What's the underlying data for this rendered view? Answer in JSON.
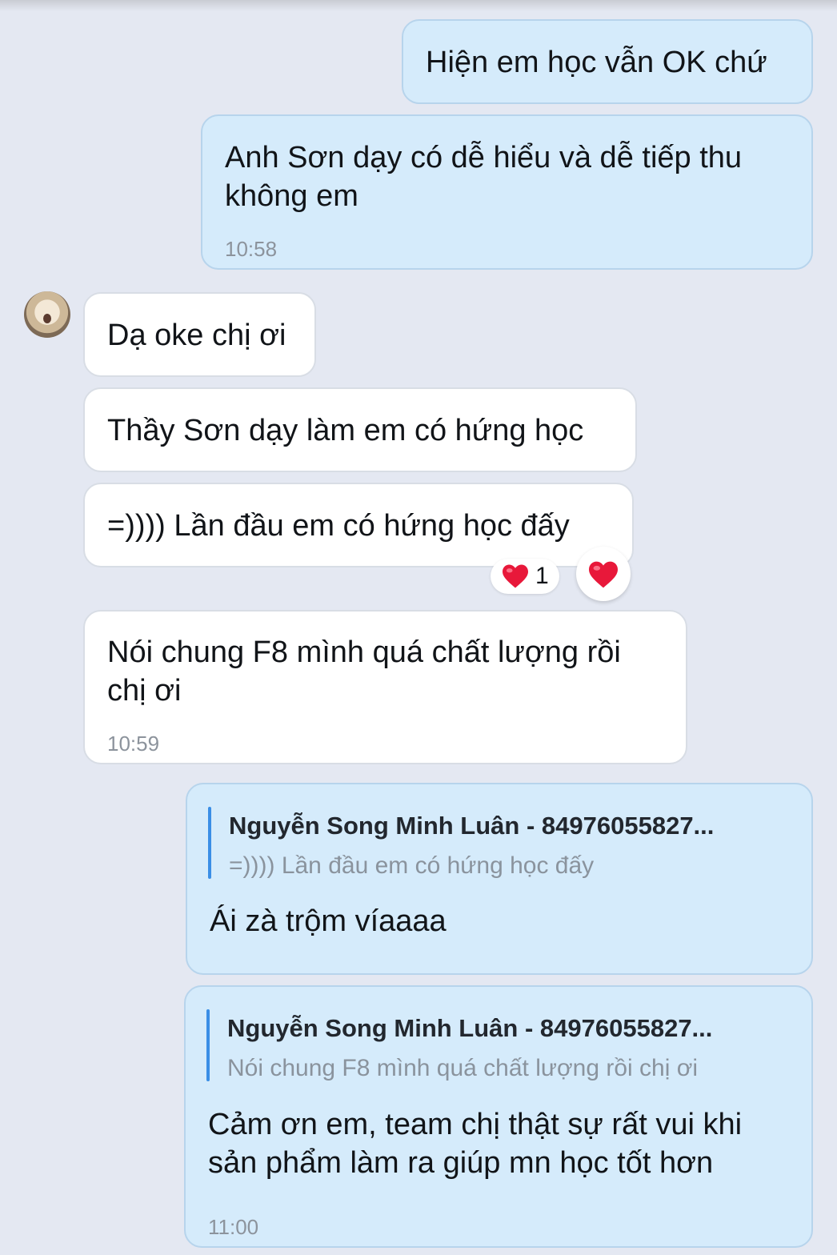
{
  "messages": {
    "m1": {
      "text": "Hiện em học vẫn OK chứ"
    },
    "m2": {
      "text": "Anh Sơn dạy có dễ hiểu và dễ tiếp thu không em",
      "time": "10:58"
    },
    "m3": {
      "text": "Dạ oke chị ơi"
    },
    "m4": {
      "text": "Thầy Sơn dạy làm em có hứng học"
    },
    "m5": {
      "text": "=)))) Lần đầu em có hứng học đấy",
      "reaction_icon": "heart-icon",
      "reaction_count": "1"
    },
    "m6": {
      "text": "Nói chung F8 mình quá chất lượng rồi chị ơi",
      "time": "10:59"
    },
    "m7": {
      "reply_name": "Nguyễn Song Minh Luân - 84976055827...",
      "reply_text": "=)))) Lần đầu em có hứng học đấy",
      "text": "Ái zà trộm víaaaa"
    },
    "m8": {
      "reply_name": "Nguyễn Song Minh Luân - 84976055827...",
      "reply_text": "Nói chung F8 mình quá chất lượng rồi chị ơi",
      "text": "Cảm ơn em, team chị thật sự rất vui khi sản phẩm làm ra giúp mn học tốt hơn",
      "time": "11:00"
    }
  },
  "colors": {
    "background": "#e4e8f2",
    "outgoing_bubble": "#d5ebfb",
    "incoming_bubble": "#ffffff",
    "reply_accent": "#3a8ee6",
    "heart": "#e8183a"
  },
  "icons": {
    "avatar": "cat-avatar",
    "reaction_button": "heart-icon"
  }
}
